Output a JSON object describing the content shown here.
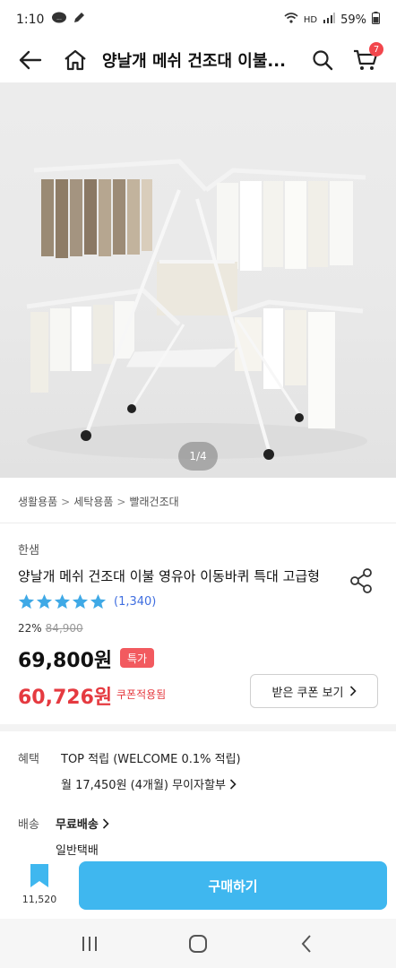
{
  "status_bar": {
    "time": "1:10",
    "network": "HD",
    "battery": "59%"
  },
  "header": {
    "title": "양날개 메쉬 건조대 이불...",
    "cart_count": "7"
  },
  "image": {
    "pager": "1/4"
  },
  "breadcrumb": [
    "생활용품",
    "세탁용품",
    "빨래건조대"
  ],
  "product": {
    "brand": "한샘",
    "title": "양날개 메쉬 건조대 이불 영유아 이동바퀴 특대 고급형",
    "review_count": "(1,340)",
    "discount_rate": "22%",
    "original_price": "84,900",
    "price": "69,800원",
    "special_badge": "특가",
    "coupon_price": "60,726원",
    "coupon_label": "쿠폰적용됨",
    "coupon_button": "받은 쿠폰 보기"
  },
  "benefits": {
    "label": "혜택",
    "line1": "TOP 적립 (WELCOME 0.1% 적립)",
    "line2": "월 17,450원 (4개월) 무이자할부"
  },
  "shipping": {
    "label": "배송",
    "line1": "무료배송",
    "line2": "일반택배"
  },
  "bottom_bar": {
    "bookmark_count": "11,520",
    "buy_label": "구매하기"
  },
  "colors": {
    "accent": "#3fb7ef",
    "sale_red": "#e53a40",
    "star": "#3fa9e6",
    "badge": "#f25a5f"
  }
}
